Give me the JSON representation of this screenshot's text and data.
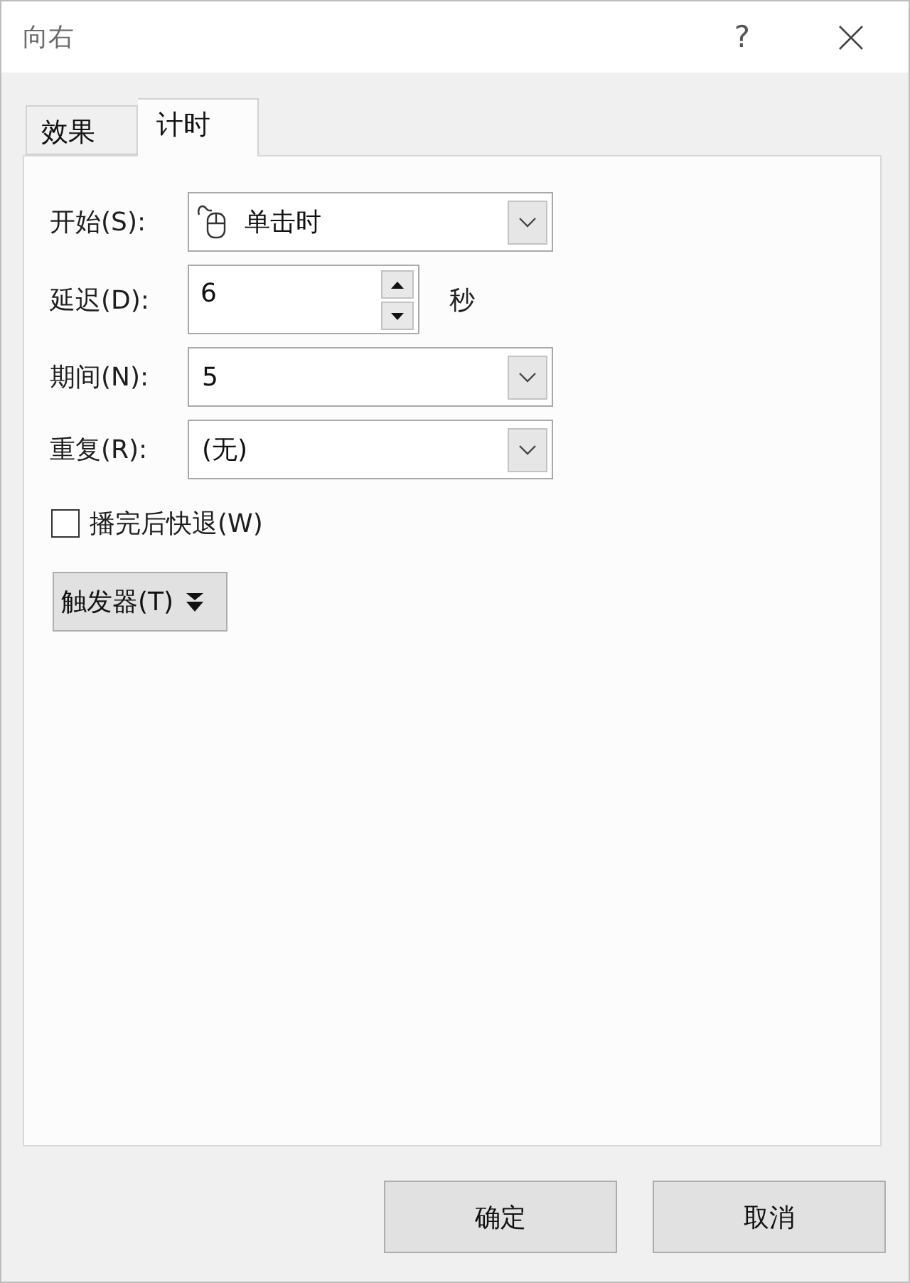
{
  "window": {
    "title": "向右",
    "help": "?"
  },
  "tabs": [
    {
      "label": "效果",
      "selected": false
    },
    {
      "label": "计时",
      "selected": true
    }
  ],
  "fields": [
    {
      "kind": "select",
      "label": "开始(S):",
      "value": "单击时",
      "has_icon": true
    },
    {
      "kind": "spinner",
      "label": "延迟(D):",
      "value": "6",
      "unit": "秒"
    },
    {
      "kind": "select",
      "label": "期间(N):",
      "value": "5"
    },
    {
      "kind": "select",
      "label": "重复(R):",
      "value": "(无)"
    }
  ],
  "checkbox": {
    "label": "播完后快退(W)",
    "checked": false
  },
  "trigger_button": {
    "label": "触发器(T)"
  },
  "buttons": [
    "确定",
    "取消"
  ]
}
